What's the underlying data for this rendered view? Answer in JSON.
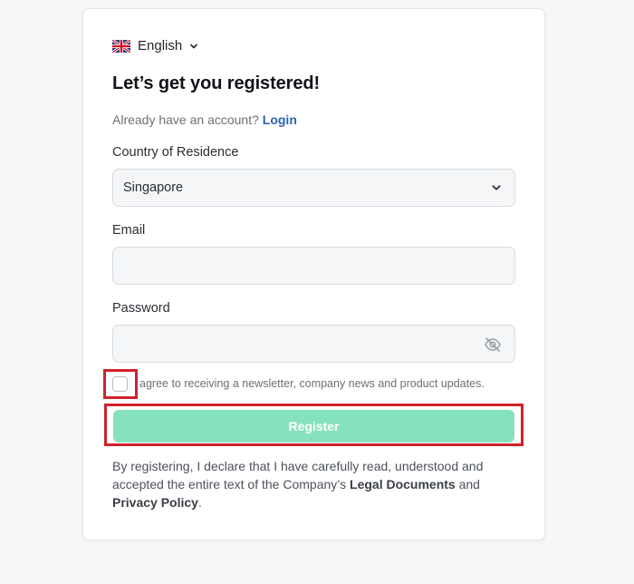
{
  "language": {
    "label": "English",
    "flag_icon": "uk-flag-icon"
  },
  "title": "Let’s get you registered!",
  "already": {
    "prefix": "Already have an account?",
    "login_label": "Login"
  },
  "country": {
    "label": "Country of Residence",
    "value": "Singapore"
  },
  "email": {
    "label": "Email",
    "value": "",
    "placeholder": ""
  },
  "password": {
    "label": "Password",
    "value": "",
    "placeholder": ""
  },
  "newsletter": {
    "text": "agree to receiving a newsletter, company news and product updates.",
    "checked": false
  },
  "register": {
    "label": "Register"
  },
  "declaration": {
    "prefix": "By registering, I declare that I have carefully read, understood and accepted the entire text of the Company’s",
    "legal_link": "Legal Documents",
    "and": "and",
    "privacy_link": "Privacy Policy",
    "suffix": "."
  },
  "colors": {
    "accent_link": "#2c63b0",
    "register_button": "#86e2be",
    "highlight_box": "#d1212b"
  }
}
